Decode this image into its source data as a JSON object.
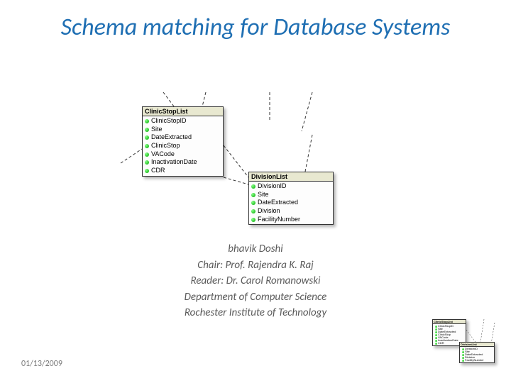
{
  "title": "Schema matching for Database Systems",
  "boxes": {
    "clinic": {
      "header": "ClinicStopList",
      "fields": [
        "ClinicStopID",
        "Site",
        "DateExtracted",
        "ClinicStop",
        "VACode",
        "InactivationDate",
        "CDR"
      ]
    },
    "division": {
      "header": "DivisionList",
      "fields": [
        "DivisionID",
        "Site",
        "DateExtracted",
        "Division",
        "FacilityNumber"
      ]
    }
  },
  "credits": {
    "author": "bhavik Doshi",
    "chair": "Chair: Prof. Rajendra K. Raj",
    "reader": "Reader: Dr. Carol Romanowski",
    "dept": "Department of Computer Science",
    "school": "Rochester Institute of Technology"
  },
  "date": "01/13/2009"
}
